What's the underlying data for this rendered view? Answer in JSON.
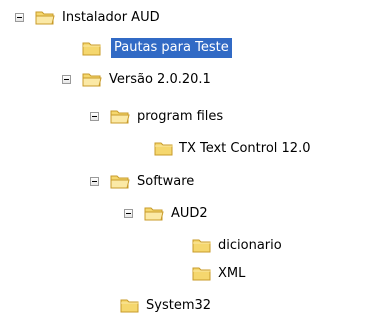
{
  "tree": {
    "nodes": [
      {
        "label": "Instalador AUD",
        "expanded": true,
        "selected": false,
        "icon": "folder-open-icon"
      },
      {
        "label": "Pautas para Teste",
        "expanded": false,
        "selected": true,
        "icon": "folder-icon"
      },
      {
        "label": "Versão 2.0.20.1",
        "expanded": true,
        "selected": false,
        "icon": "folder-open-icon"
      },
      {
        "label": "program files",
        "expanded": true,
        "selected": false,
        "icon": "folder-open-icon"
      },
      {
        "label": "TX Text Control 12.0",
        "expanded": false,
        "selected": false,
        "icon": "folder-icon"
      },
      {
        "label": "Software",
        "expanded": true,
        "selected": false,
        "icon": "folder-open-icon"
      },
      {
        "label": "AUD2",
        "expanded": true,
        "selected": false,
        "icon": "folder-open-icon"
      },
      {
        "label": "dicionario",
        "expanded": false,
        "selected": false,
        "icon": "folder-icon"
      },
      {
        "label": "XML",
        "expanded": false,
        "selected": false,
        "icon": "folder-icon"
      },
      {
        "label": "System32",
        "expanded": false,
        "selected": false,
        "icon": "folder-icon"
      }
    ]
  },
  "colors": {
    "selection": "#316ac5",
    "folder": "#f5d76e",
    "folder_outline": "#c89b2a"
  }
}
